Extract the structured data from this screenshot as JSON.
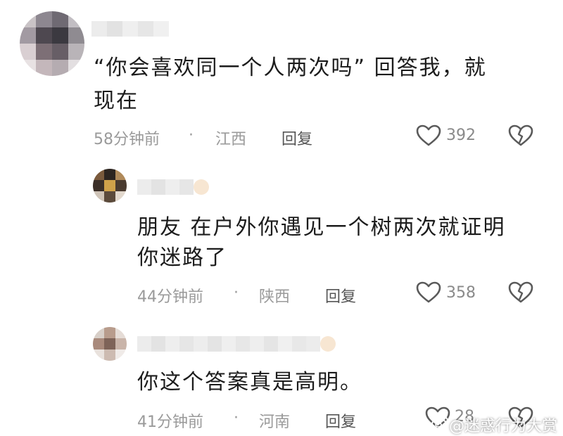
{
  "comments": [
    {
      "text_line1": "“你会喜欢同一个人两次吗”  回答我，就",
      "text_line2": "现在",
      "time": "58分钟前",
      "dot": "·",
      "location": "江西",
      "reply": "回复",
      "likes": "392"
    },
    {
      "text_line1": "朋友 在户外你遇见一个树两次就证明",
      "text_line2": "你迷路了",
      "time": "44分钟前",
      "dot": "·",
      "location": "陕西",
      "reply": "回复",
      "likes": "358"
    },
    {
      "text_line1": "你这个答案真是高明。",
      "time": "41分钟前",
      "dot": "·",
      "location": "河南",
      "reply": "回复",
      "likes": "28"
    }
  ],
  "icons": {
    "like": "heart-outline-icon",
    "dislike": "broken-heart-icon"
  },
  "watermark": "@迷惑行为大赏"
}
